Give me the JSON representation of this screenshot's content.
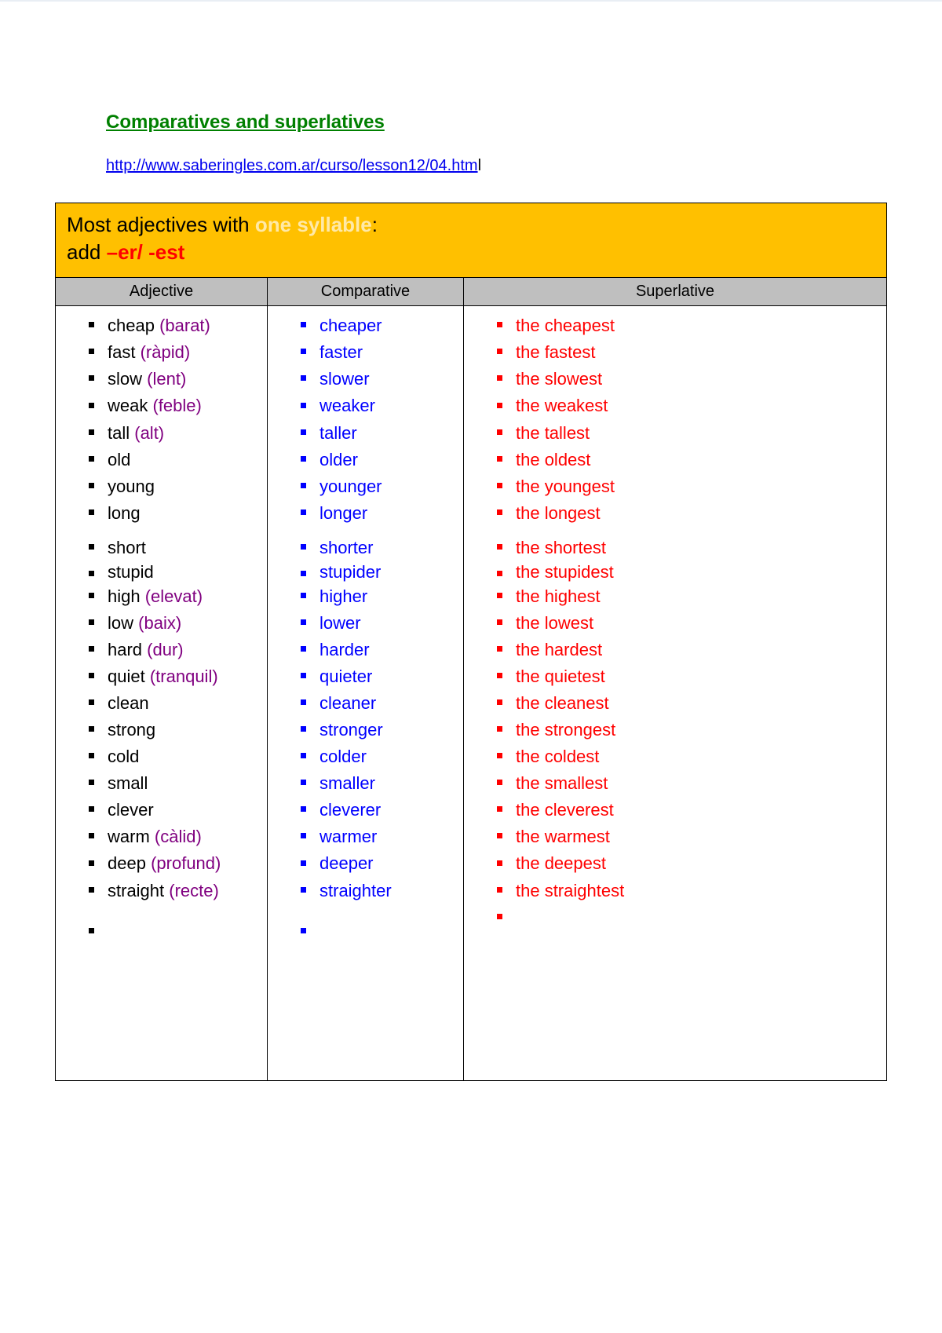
{
  "doc_title": "Comparatives and superlatives",
  "source_url_visible": "http://www.saberingles.com.ar/curso/lesson12/04.htm",
  "source_url_tail": "l",
  "rule": {
    "line1_prefix": "Most adjectives with ",
    "line1_highlight": "one syllable",
    "line1_suffix": ":",
    "line2_prefix": "add ",
    "line2_suffix": "–er/  -est"
  },
  "columns": {
    "adjective": "Adjective",
    "comparative": "Comparative",
    "superlative": "Superlative"
  },
  "rows": [
    {
      "adj": "cheap",
      "tr": "(barat)",
      "comp": "cheaper",
      "sup": "the cheapest"
    },
    {
      "adj": "fast",
      "tr": "(ràpid)",
      "comp": "faster",
      "sup": "the fastest"
    },
    {
      "adj": "slow",
      "tr": "(lent)",
      "comp": "slower",
      "sup": "the slowest"
    },
    {
      "adj": "weak",
      "tr": "(feble)",
      "comp": "weaker",
      "sup": "the weakest"
    },
    {
      "adj": "tall",
      "tr": "(alt)",
      "comp": "taller",
      "sup": "the tallest"
    },
    {
      "adj": "old",
      "tr": "",
      "comp": "older",
      "sup": "the oldest"
    },
    {
      "adj": "young",
      "tr": "",
      "comp": "younger",
      "sup": "the youngest"
    },
    {
      "adj": "long",
      "tr": "",
      "comp": "longer",
      "sup": "the longest"
    },
    {
      "adj": "short",
      "tr": "",
      "comp": "shorter",
      "sup": "the shortest",
      "gap_before": true
    },
    {
      "adj": "stupid",
      "tr": "",
      "comp": "stupider",
      "sup": "the stupidest",
      "tight": true
    },
    {
      "adj": "high",
      "tr": "(elevat)",
      "comp": "higher",
      "sup": "the highest"
    },
    {
      "adj": "low",
      "tr": "(baix)",
      "comp": "lower",
      "sup": "the lowest"
    },
    {
      "adj": "hard",
      "tr": "(dur)",
      "comp": "harder",
      "sup": "the hardest"
    },
    {
      "adj": "quiet",
      "tr": "(tranquil)",
      "comp": "quieter",
      "sup": "the quietest"
    },
    {
      "adj": "clean",
      "tr": "",
      "comp": "cleaner",
      "sup": "the cleanest"
    },
    {
      "adj": "strong",
      "tr": "",
      "comp": "stronger",
      "sup": "the strongest"
    },
    {
      "adj": "cold",
      "tr": "",
      "comp": "colder",
      "sup": "the coldest"
    },
    {
      "adj": "small",
      "tr": "",
      "comp": "smaller",
      "sup": "the smallest"
    },
    {
      "adj": "clever",
      "tr": "",
      "comp": "cleverer",
      "sup": "the cleverest"
    },
    {
      "adj": "warm",
      "tr": "(càlid)",
      "comp": "warmer",
      "sup": "the warmest"
    },
    {
      "adj": "deep",
      "tr": "(profund)",
      "comp": "deeper",
      "sup": "the deepest"
    },
    {
      "adj": "straight",
      "tr": "(recte)",
      "comp": "straighter",
      "sup": "the straightest"
    }
  ],
  "trailing_empty": {
    "sup_only_first": true,
    "adj_comp_second": true
  }
}
